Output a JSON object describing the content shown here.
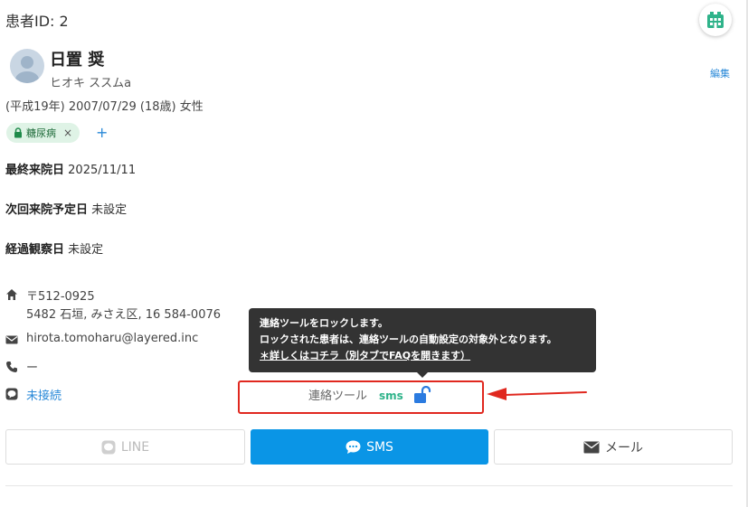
{
  "header": {
    "patient_id": "患者ID: 2"
  },
  "patient": {
    "name": "日置 奨",
    "kana": "ヒオキ ススムa",
    "birth": "(平成19年) 2007/07/29 (18歳) 女性",
    "edit_label": "編集",
    "tag_label": "糖尿病",
    "tag_remove": "×",
    "tag_add": "+"
  },
  "fields": {
    "last_visit_label": "最終来院日",
    "last_visit_value": "2025/11/11",
    "next_visit_label": "次回来院予定日",
    "next_visit_value": "未設定",
    "observation_label": "経過観察日",
    "observation_value": "未設定"
  },
  "contact_info": {
    "postal": "〒512-0925",
    "address": "5482 石垣, みさえ区, 16 584-0076",
    "email": "hirota.tomoharu@layered.inc",
    "phone": "ー",
    "line_status": "未接続"
  },
  "tooltip": {
    "line1": "連絡ツールをロックします。",
    "line2": "ロックされた患者は、連絡ツールの自動設定の対象外となります。",
    "line3": "＊詳しくはコチラ（別タブでFAQを開きます）"
  },
  "contact_tool": {
    "label": "連絡ツール",
    "value": "sms"
  },
  "buttons": {
    "line": "LINE",
    "sms": "SMS",
    "mail": "メール"
  },
  "colors": {
    "accent": "#0a95e6",
    "link": "#2b8ad8",
    "highlight": "#e0281f",
    "tag_bg": "#dff3e6",
    "sms_text": "#2fb38a"
  },
  "icons": {
    "corner": "hospital-icon",
    "address": "home-icon",
    "email": "mail-icon",
    "phone": "phone-icon",
    "line": "line-icon",
    "lock": "unlock-icon",
    "tag": "lock-icon"
  }
}
